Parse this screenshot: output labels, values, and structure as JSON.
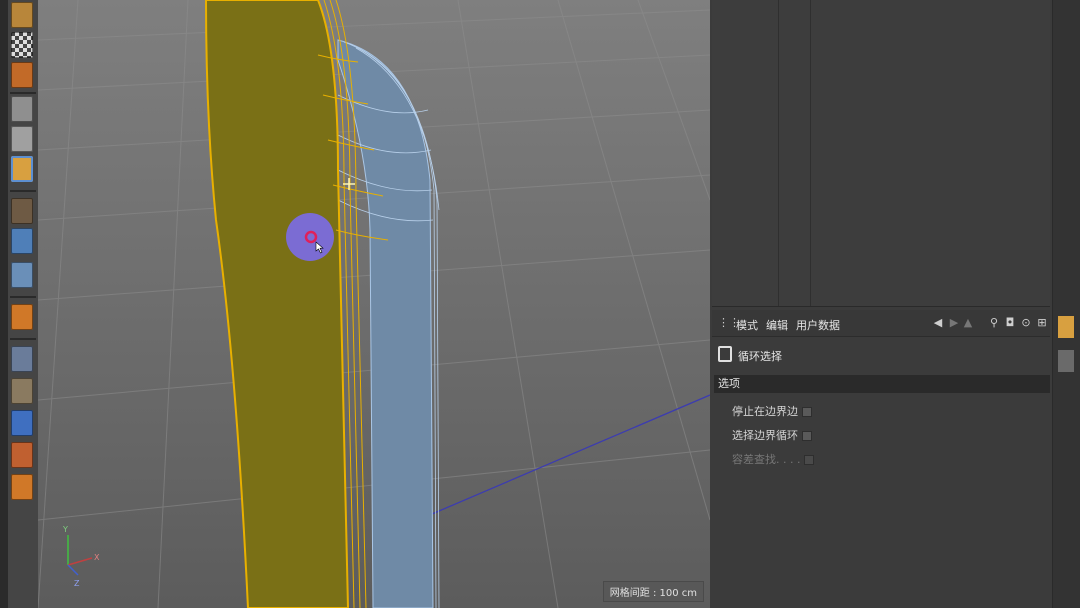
{
  "toolbar": {
    "icons": [
      {
        "name": "cube-view-icon",
        "color": "#b8863a"
      },
      {
        "name": "checker-texture-icon",
        "color": "#8a8a8a"
      },
      {
        "name": "texture-mode-icon",
        "color": "#c26a28"
      },
      {
        "name": "model-mode-icon",
        "color": "#9a9a9a"
      },
      {
        "name": "object-mode-icon",
        "color": "#9a9a9a"
      },
      {
        "name": "polygon-mode-icon",
        "color": "#d8a040"
      },
      {
        "name": "axis-mode-icon",
        "color": "#c26a28"
      },
      {
        "name": "magnet-icon",
        "color": "#4f7fb8"
      },
      {
        "name": "snap-icon",
        "color": "#6a8fb8"
      },
      {
        "name": "spline-icon",
        "color": "#d07828"
      },
      {
        "name": "grid-tool-icon",
        "color": "#6a7c9a"
      },
      {
        "name": "deformer-icon",
        "color": "#8a7a60"
      },
      {
        "name": "arrow-down-icon",
        "color": "#3f6fc0"
      },
      {
        "name": "scatter-icon",
        "color": "#c06030"
      },
      {
        "name": "sculpt-icon",
        "color": "#d07828"
      }
    ]
  },
  "viewport": {
    "grid_label": "网格间距 : 100 cm",
    "axis": {
      "y": "Y",
      "x": "X",
      "z": "Z"
    }
  },
  "attributes": {
    "menu": [
      "模式",
      "编辑",
      "用户数据"
    ],
    "tool_name": "循环选择",
    "section": "选项",
    "options": [
      {
        "label": "停止在边界边",
        "enabled": true
      },
      {
        "label": "选择边界循环",
        "enabled": true
      },
      {
        "label": "容差查找. . . .",
        "enabled": false
      }
    ]
  },
  "right_tabs": [
    "attribute-tab",
    "layer-tab"
  ]
}
